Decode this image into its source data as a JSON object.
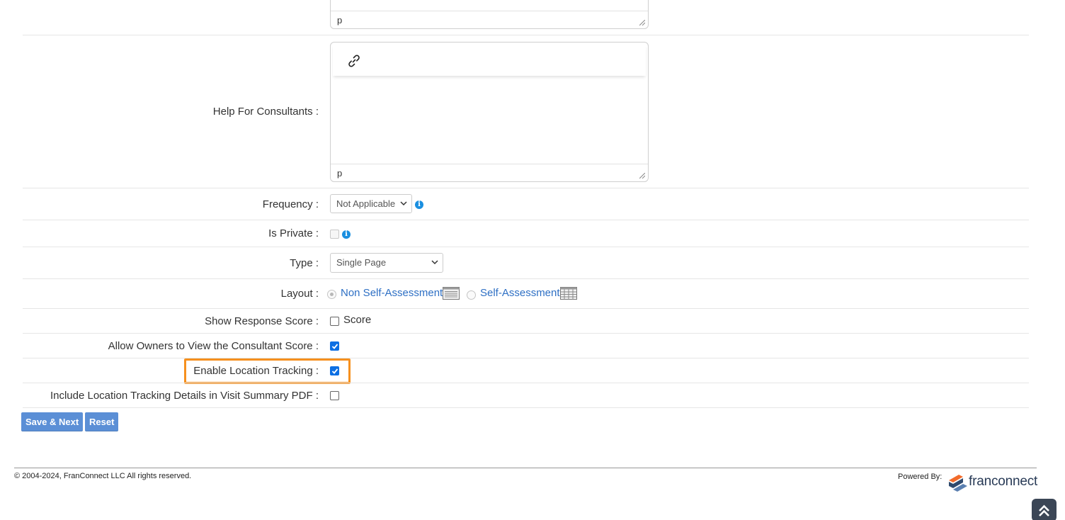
{
  "editor_top": {
    "status_tag": "p"
  },
  "help_for_consultants": {
    "label": "Help For Consultants :",
    "status_tag": "p",
    "toolbar_icon": "link-icon"
  },
  "frequency": {
    "label": "Frequency :",
    "selected": "Not Applicable",
    "info_icon": "info-icon"
  },
  "is_private": {
    "label": "Is Private :",
    "info_icon": "info-icon"
  },
  "type": {
    "label": "Type :",
    "selected": "Single Page"
  },
  "layout": {
    "label": "Layout :",
    "options": [
      {
        "label": "Non Self-Assessment",
        "icon": "list-layout-icon",
        "selected": true
      },
      {
        "label": "Self-Assessment",
        "icon": "grid-layout-icon",
        "selected": false
      }
    ]
  },
  "show_response_score": {
    "label": "Show Response Score :",
    "option": "Score",
    "checked": false
  },
  "allow_owners": {
    "label": "Allow Owners to View the Consultant Score :",
    "checked": true
  },
  "enable_location_tracking": {
    "label": "Enable Location Tracking :",
    "checked": true,
    "highlight_color": "#f6901e"
  },
  "include_location_details": {
    "label": "Include Location Tracking Details in Visit Summary PDF :",
    "checked": false
  },
  "buttons": {
    "save_next": "Save & Next",
    "reset": "Reset"
  },
  "footer": {
    "copyright": "© 2004-2024, FranConnect LLC All rights reserved.",
    "powered_by": "Powered By:",
    "logo_text": "franconnect"
  },
  "colors": {
    "accent": "#5b8fd6",
    "link": "#2d6fc4",
    "checkbox": "#0d6fe3"
  }
}
